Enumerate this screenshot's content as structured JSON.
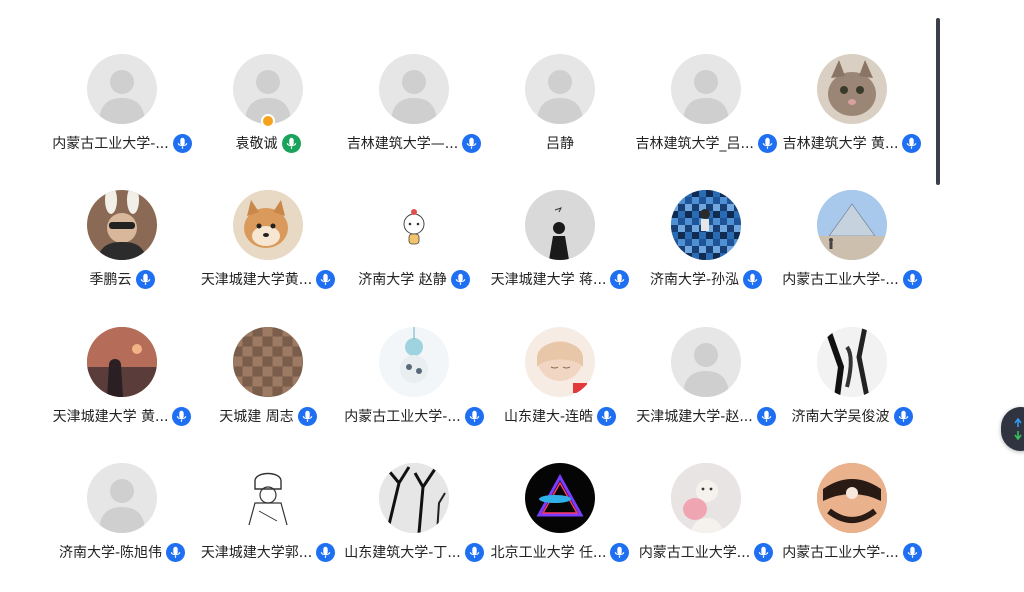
{
  "participants": [
    {
      "name": "内蒙古工业大学-...",
      "avatar": "default-avatar",
      "mic": "mic-on-icon",
      "mic_color": "#1f6ff2"
    },
    {
      "name": "袁敬诚",
      "avatar": "default-avatar",
      "mic": "mic-speaking-icon",
      "mic_color": "#1aa35a",
      "host": true
    },
    {
      "name": "吉林建筑大学—...",
      "avatar": "default-avatar",
      "mic": "mic-on-icon",
      "mic_color": "#1f6ff2"
    },
    {
      "name": "吕静",
      "avatar": "default-avatar",
      "mic": "",
      "mic_color": ""
    },
    {
      "name": "吉林建筑大学_吕...",
      "avatar": "default-avatar",
      "mic": "mic-on-icon",
      "mic_color": "#1f6ff2"
    },
    {
      "name": "吉林建筑大学 黄...",
      "avatar": "cat-photo-avatar",
      "mic": "mic-on-icon",
      "mic_color": "#1f6ff2"
    },
    {
      "name": "季鹏云",
      "avatar": "bunny-ears-photo-avatar",
      "mic": "mic-on-icon",
      "mic_color": "#1f6ff2"
    },
    {
      "name": "天津城建大学黄...",
      "avatar": "shiba-dog-avatar",
      "mic": "mic-on-icon",
      "mic_color": "#1f6ff2"
    },
    {
      "name": "济南大学 赵静",
      "avatar": "cartoon-doodle-avatar",
      "mic": "mic-on-icon",
      "mic_color": "#1f6ff2"
    },
    {
      "name": "天津城建大学 蒋...",
      "avatar": "grey-silhouette-avatar",
      "mic": "mic-on-icon",
      "mic_color": "#1f6ff2"
    },
    {
      "name": "济南大学-孙泓",
      "avatar": "blue-mosaic-avatar",
      "mic": "mic-on-icon",
      "mic_color": "#1f6ff2"
    },
    {
      "name": "内蒙古工业大学-...",
      "avatar": "louvre-pyramid-avatar",
      "mic": "mic-on-icon",
      "mic_color": "#1f6ff2"
    },
    {
      "name": "天津城建大学 黄...",
      "avatar": "sunset-photo-avatar",
      "mic": "mic-on-icon",
      "mic_color": "#1f6ff2"
    },
    {
      "name": "天城建  周志",
      "avatar": "rooftops-avatar",
      "mic": "mic-on-icon",
      "mic_color": "#1f6ff2"
    },
    {
      "name": "内蒙古工业大学-...",
      "avatar": "plush-toy-avatar",
      "mic": "mic-on-icon",
      "mic_color": "#1f6ff2"
    },
    {
      "name": "山东建大-连皓",
      "avatar": "anime-girl-avatar",
      "mic": "mic-on-icon",
      "mic_color": "#1f6ff2"
    },
    {
      "name": "天津城建大学-赵...",
      "avatar": "default-avatar",
      "mic": "mic-on-icon",
      "mic_color": "#1f6ff2"
    },
    {
      "name": "济南大学吴俊波",
      "avatar": "bw-statue-avatar",
      "mic": "mic-on-icon",
      "mic_color": "#1f6ff2"
    },
    {
      "name": "济南大学-陈旭伟",
      "avatar": "default-avatar",
      "mic": "mic-on-icon",
      "mic_color": "#1f6ff2"
    },
    {
      "name": "天津城建大学郭...",
      "avatar": "line-sketch-avatar",
      "mic": "mic-on-icon",
      "mic_color": "#1f6ff2"
    },
    {
      "name": "山东建筑大学-丁...",
      "avatar": "bw-trees-avatar",
      "mic": "mic-on-icon",
      "mic_color": "#1f6ff2"
    },
    {
      "name": "北京工业大学 任...",
      "avatar": "neon-triangle-avatar",
      "mic": "mic-on-icon",
      "mic_color": "#1f6ff2"
    },
    {
      "name": "内蒙古工业大学...",
      "avatar": "pink-plush-avatar",
      "mic": "mic-on-icon",
      "mic_color": "#1f6ff2"
    },
    {
      "name": "内蒙古工业大学-...",
      "avatar": "cartoon-face-avatar",
      "mic": "mic-on-icon",
      "mic_color": "#1f6ff2"
    }
  ],
  "colors": {
    "default_avatar_bg": "#e6e6e6",
    "default_avatar_fg": "#cfcfcf",
    "host_badge": "#f6a21b",
    "scrollbar": "#3a3f4a",
    "nav_up": "#2f9bf0",
    "nav_down": "#36c25a"
  },
  "floating_nav": {
    "up_icon": "arrow-up-icon",
    "down_icon": "arrow-down-icon"
  }
}
